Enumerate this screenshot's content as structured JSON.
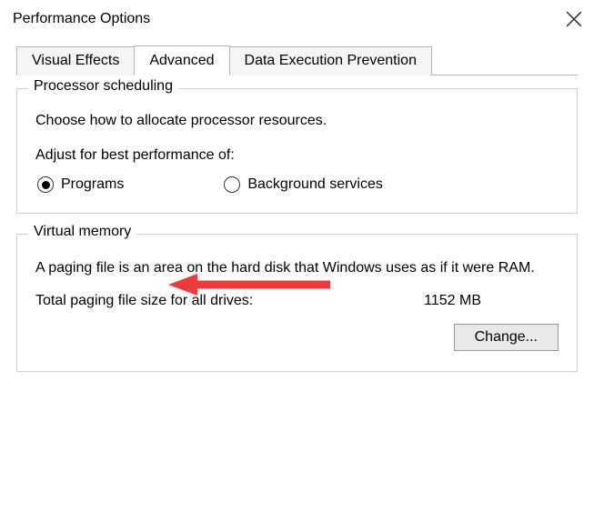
{
  "title": "Performance Options",
  "tabs": {
    "visual_effects": "Visual Effects",
    "advanced": "Advanced",
    "data_execution": "Data Execution Prevention"
  },
  "processor": {
    "legend": "Processor scheduling",
    "desc": "Choose how to allocate processor resources.",
    "adjust_label": "Adjust for best performance of:",
    "option_programs": "Programs",
    "option_bg": "Background services",
    "selected": "programs"
  },
  "virtual_memory": {
    "legend": "Virtual memory",
    "desc": "A paging file is an area on the hard disk that Windows uses as if it were RAM.",
    "total_label": "Total paging file size for all drives:",
    "total_value": "1152 MB",
    "change_label": "Change..."
  },
  "annotation": {
    "arrow_color": "#ed3b3b"
  }
}
